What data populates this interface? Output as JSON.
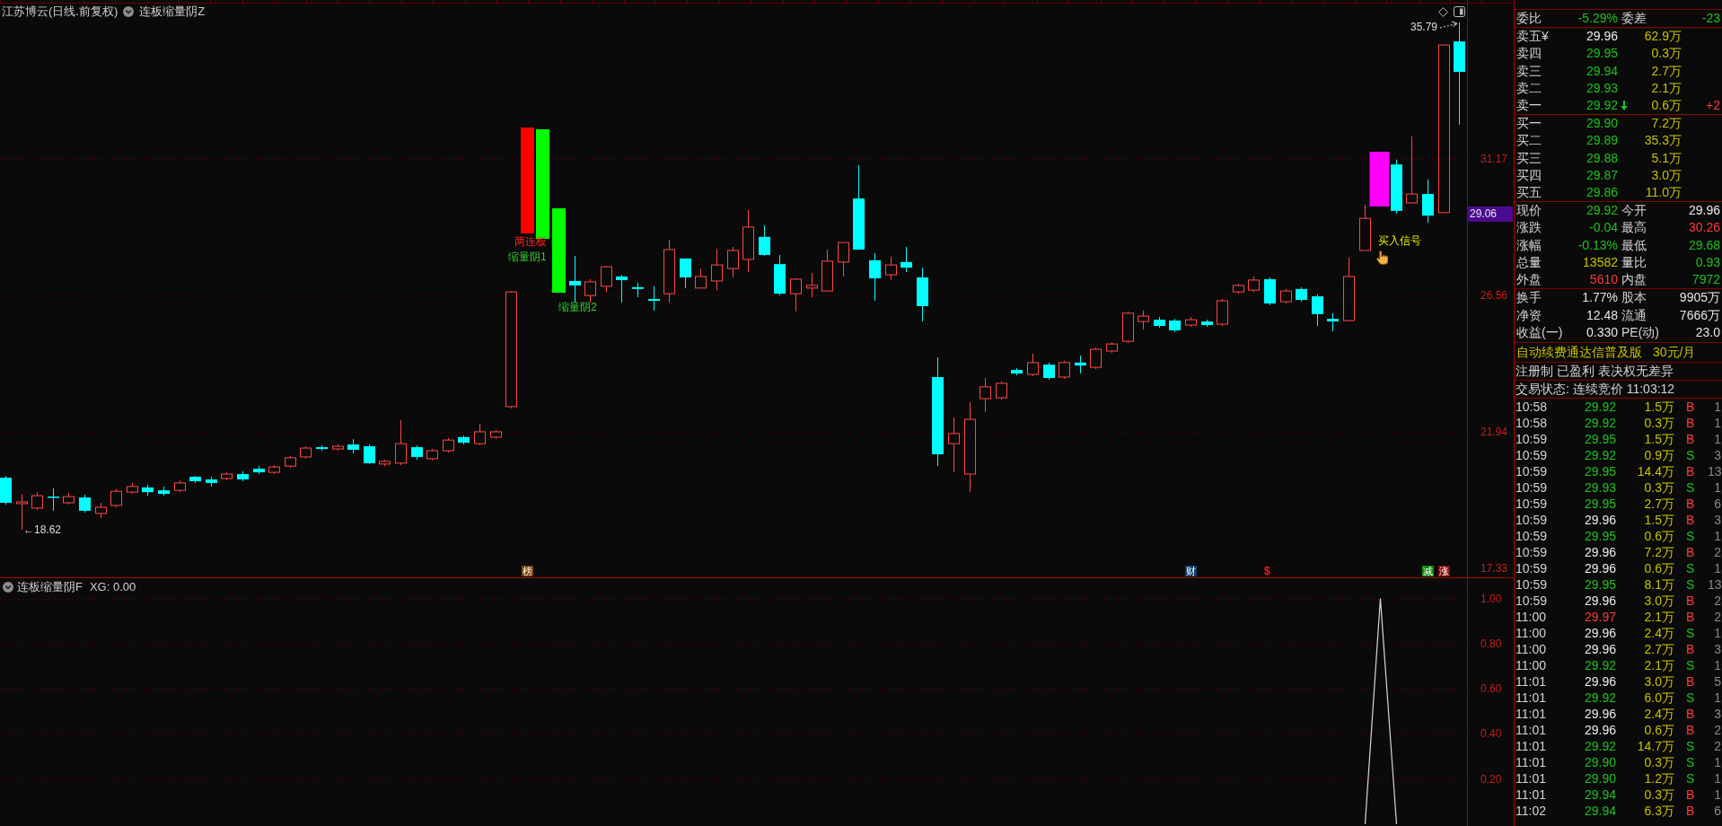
{
  "chart_header": {
    "title": "江苏博云(日线.前复权)",
    "indicator": "连板缩量阴Z"
  },
  "main_chart": {
    "chart_data": {
      "type": "candlestick",
      "ohlc": [
        [
          20.39,
          20.45,
          19.48,
          19.54
        ],
        [
          19.51,
          19.84,
          18.62,
          19.57
        ],
        [
          19.36,
          19.9,
          19.3,
          19.78
        ],
        [
          19.75,
          20.03,
          19.27,
          19.72
        ],
        [
          19.54,
          19.87,
          19.48,
          19.75
        ],
        [
          19.72,
          19.81,
          19.21,
          19.27
        ],
        [
          19.18,
          19.54,
          19.02,
          19.39
        ],
        [
          19.45,
          20.0,
          19.39,
          19.93
        ],
        [
          19.9,
          20.21,
          19.84,
          20.09
        ],
        [
          20.06,
          20.15,
          19.78,
          19.9
        ],
        [
          19.96,
          20.09,
          19.78,
          19.84
        ],
        [
          19.96,
          20.3,
          19.9,
          20.21
        ],
        [
          20.42,
          20.45,
          20.21,
          20.27
        ],
        [
          20.33,
          20.42,
          20.09,
          20.21
        ],
        [
          20.36,
          20.57,
          20.3,
          20.51
        ],
        [
          20.51,
          20.6,
          20.27,
          20.33
        ],
        [
          20.69,
          20.78,
          20.51,
          20.57
        ],
        [
          20.57,
          20.81,
          20.51,
          20.75
        ],
        [
          20.78,
          21.12,
          20.72,
          21.06
        ],
        [
          21.09,
          21.45,
          21.03,
          21.39
        ],
        [
          21.42,
          21.48,
          21.3,
          21.36
        ],
        [
          21.36,
          21.51,
          21.3,
          21.45
        ],
        [
          21.51,
          21.69,
          21.21,
          21.33
        ],
        [
          21.45,
          21.51,
          20.85,
          20.88
        ],
        [
          20.85,
          21.0,
          20.78,
          20.94
        ],
        [
          20.88,
          22.33,
          20.81,
          21.54
        ],
        [
          21.42,
          21.48,
          21.0,
          21.09
        ],
        [
          21.03,
          21.36,
          20.97,
          21.3
        ],
        [
          21.3,
          21.73,
          21.24,
          21.66
        ],
        [
          21.76,
          21.82,
          21.51,
          21.57
        ],
        [
          21.54,
          22.21,
          21.48,
          21.94
        ],
        [
          21.76,
          22.0,
          21.69,
          21.94
        ],
        [
          22.79,
          26.7,
          22.73,
          26.67
        ],
        null,
        null,
        null,
        [
          27.04,
          27.89,
          26.31,
          26.89
        ],
        [
          26.55,
          27.1,
          26.31,
          27.01
        ],
        [
          26.86,
          27.55,
          26.67,
          27.52
        ],
        [
          27.19,
          27.25,
          26.31,
          27.07
        ],
        [
          26.83,
          26.98,
          26.49,
          26.77
        ],
        [
          26.43,
          26.86,
          26.04,
          26.37
        ],
        [
          26.61,
          28.43,
          26.31,
          28.1
        ],
        [
          27.8,
          27.8,
          26.8,
          27.16
        ],
        [
          26.8,
          27.46,
          26.8,
          27.19
        ],
        [
          27.04,
          28.13,
          26.73,
          27.58
        ],
        [
          27.46,
          28.19,
          27.16,
          28.07
        ],
        [
          27.77,
          29.44,
          27.34,
          28.86
        ],
        [
          28.53,
          28.92,
          27.89,
          27.92
        ],
        [
          27.61,
          27.92,
          26.55,
          26.61
        ],
        [
          26.61,
          27.13,
          26.01,
          27.1
        ],
        [
          26.8,
          27.31,
          26.49,
          26.89
        ],
        [
          26.7,
          28.1,
          26.7,
          27.71
        ],
        [
          27.68,
          28.34,
          27.19,
          28.34
        ],
        [
          29.83,
          30.95,
          28.1,
          28.1
        ],
        [
          27.74,
          27.98,
          26.37,
          27.13
        ],
        [
          27.25,
          27.86,
          27.07,
          27.58
        ],
        [
          27.68,
          28.19,
          27.34,
          27.49
        ],
        [
          27.16,
          27.49,
          25.67,
          26.19
        ],
        [
          23.79,
          24.46,
          20.78,
          21.18
        ],
        [
          21.54,
          22.42,
          20.57,
          21.88
        ],
        [
          20.51,
          22.94,
          19.9,
          22.36
        ],
        [
          23.06,
          23.76,
          22.61,
          23.46
        ],
        [
          23.09,
          23.64,
          23.03,
          23.58
        ],
        [
          24.03,
          24.09,
          23.85,
          23.91
        ],
        [
          23.88,
          24.58,
          23.82,
          24.28
        ],
        [
          24.21,
          24.28,
          23.7,
          23.76
        ],
        [
          23.79,
          24.34,
          23.73,
          24.28
        ],
        [
          24.28,
          24.52,
          23.91,
          24.18
        ],
        [
          24.12,
          24.79,
          24.06,
          24.73
        ],
        [
          24.67,
          24.97,
          24.61,
          24.91
        ],
        [
          25.0,
          26.01,
          24.94,
          25.95
        ],
        [
          25.67,
          26.04,
          25.4,
          25.85
        ],
        [
          25.73,
          25.82,
          25.46,
          25.52
        ],
        [
          25.7,
          25.76,
          25.31,
          25.37
        ],
        [
          25.55,
          25.82,
          25.49,
          25.73
        ],
        [
          25.67,
          25.73,
          25.49,
          25.55
        ],
        [
          25.58,
          26.43,
          25.52,
          26.37
        ],
        [
          26.67,
          26.95,
          26.61,
          26.89
        ],
        [
          26.73,
          27.19,
          26.67,
          27.07
        ],
        [
          27.1,
          27.16,
          26.22,
          26.28
        ],
        [
          26.34,
          26.77,
          26.28,
          26.7
        ],
        [
          26.77,
          26.83,
          26.34,
          26.4
        ],
        [
          26.52,
          26.58,
          25.52,
          25.92
        ],
        [
          25.76,
          25.95,
          25.34,
          25.67
        ],
        [
          25.7,
          27.83,
          25.67,
          27.19
        ],
        [
          28.07,
          29.62,
          28.07,
          29.16
        ],
        null,
        [
          30.98,
          31.14,
          29.31,
          29.41
        ],
        [
          29.68,
          31.93,
          29.68,
          29.98
        ],
        [
          29.98,
          30.47,
          29.01,
          29.25
        ],
        [
          29.35,
          35.02,
          29.35,
          35.02
        ],
        [
          35.14,
          35.79,
          32.32,
          34.11
        ]
      ],
      "ylim": [
        17.02,
        36.54
      ],
      "yticks": [
        {
          "value": 31.17,
          "label": "31.17"
        },
        {
          "value": 26.56,
          "label": "26.56"
        },
        {
          "value": 21.94,
          "label": "21.94"
        },
        {
          "value": 17.33,
          "label": "17.33"
        }
      ],
      "grid": true
    },
    "signals": [
      {
        "kind": "limit_up",
        "label": "两连板"
      },
      {
        "kind": "shrink",
        "label": "缩量阴1"
      },
      {
        "kind": "shrink",
        "label": "缩量阴2"
      },
      {
        "kind": "buy",
        "label": "买入信号"
      }
    ],
    "high_label": "35.79",
    "low_label": "←18.62",
    "event_markers": [
      {
        "kind": "tile",
        "text": "榜",
        "color": "#7a3f08"
      },
      {
        "kind": "tile",
        "text": "财",
        "color": "#0f3d6e"
      },
      {
        "kind": "glyph",
        "text": "$",
        "color": "#ff1a1a"
      },
      {
        "kind": "tile",
        "text": "减",
        "color": "#0b8a0b"
      },
      {
        "kind": "tile",
        "text": "涨",
        "color": "#8a0a0a"
      }
    ],
    "last_price_tag": "29.06"
  },
  "indicator_pane": {
    "title": "连板缩量阴F",
    "legend": "XG: 0.00",
    "chart_data": {
      "type": "line",
      "series": [
        {
          "color": "#d8d8d8",
          "values": [
            null,
            null,
            null,
            null,
            null,
            null,
            null,
            null,
            null,
            null,
            null,
            null,
            null,
            null,
            null,
            null,
            null,
            null,
            null,
            null,
            null,
            null,
            null,
            null,
            null,
            null,
            null,
            null,
            null,
            null,
            null,
            null,
            null,
            null,
            null,
            null,
            null,
            null,
            null,
            null,
            null,
            null,
            null,
            null,
            null,
            null,
            null,
            null,
            null,
            null,
            null,
            null,
            null,
            null,
            null,
            null,
            null,
            null,
            null,
            null,
            null,
            null,
            null,
            null,
            null,
            null,
            null,
            null,
            null,
            null,
            null,
            null,
            null,
            null,
            null,
            null,
            null,
            null,
            null,
            null,
            null,
            null,
            null,
            null,
            null,
            null,
            0,
            1,
            0,
            null,
            null,
            null,
            null
          ]
        }
      ],
      "ylim": [
        0,
        1.09
      ],
      "yticks": [
        {
          "value": 1,
          "label": "1.00"
        },
        {
          "value": 0.8,
          "label": "0.80"
        },
        {
          "value": 0.6,
          "label": "0.60"
        },
        {
          "value": 0.4,
          "label": "0.40"
        },
        {
          "value": 0.2,
          "label": "0.20"
        }
      ],
      "grid": true
    }
  },
  "quote_panel": {
    "order_ratio": [
      {
        "label": "委比",
        "value": "-5.29%",
        "color": "#1ec31e"
      },
      {
        "label": "委差",
        "value": "-23",
        "color": "#1ec31e"
      }
    ],
    "asks": [
      {
        "label": "卖五¥",
        "price": "29.96",
        "color": "#eeeeee",
        "volume": "62.9万"
      },
      {
        "label": "卖四",
        "price": "29.95",
        "color": "#1ec31e",
        "volume": "0.3万"
      },
      {
        "label": "卖三",
        "price": "29.94",
        "color": "#1ec31e",
        "volume": "2.7万"
      },
      {
        "label": "卖二",
        "price": "29.93",
        "color": "#1ec31e",
        "volume": "2.1万"
      },
      {
        "label": "卖一",
        "price": "29.92",
        "color": "#1ec31e",
        "arrow_down": true,
        "volume": "0.6万",
        "change": {
          "text": "+2",
          "color": "#ff3b3b"
        }
      }
    ],
    "bids": [
      {
        "label": "买一",
        "price": "29.90",
        "color": "#1ec31e",
        "volume": "7.2万"
      },
      {
        "label": "买二",
        "price": "29.89",
        "color": "#1ec31e",
        "volume": "35.3万"
      },
      {
        "label": "买三",
        "price": "29.88",
        "color": "#1ec31e",
        "volume": "5.1万"
      },
      {
        "label": "买四",
        "price": "29.87",
        "color": "#1ec31e",
        "volume": "3.0万"
      },
      {
        "label": "买五",
        "price": "29.86",
        "color": "#1ec31e",
        "volume": "11.0万"
      }
    ],
    "stats": [
      [
        {
          "label": "现价",
          "value": "29.92",
          "color": "#1ec31e"
        },
        {
          "label": "今开",
          "value": "29.96",
          "color": "#eeeeee"
        }
      ],
      [
        {
          "label": "涨跌",
          "value": "-0.04",
          "color": "#1ec31e"
        },
        {
          "label": "最高",
          "value": "30.26",
          "color": "#ff3b3b"
        }
      ],
      [
        {
          "label": "涨幅",
          "value": "-0.13%",
          "color": "#1ec31e"
        },
        {
          "label": "最低",
          "value": "29.68",
          "color": "#1ec31e"
        }
      ],
      [
        {
          "label": "总量",
          "value": "13582",
          "color": "#c8c300"
        },
        {
          "label": "量比",
          "value": "0.93",
          "color": "#1ec31e"
        }
      ],
      [
        {
          "label": "外盘",
          "value": "5610",
          "color": "#ff3b3b"
        },
        {
          "label": "内盘",
          "value": "7972",
          "color": "#1ec31e"
        }
      ]
    ],
    "fundamentals": [
      [
        {
          "label": "换手",
          "value": "1.77%"
        },
        {
          "label": "股本",
          "value": "9905万"
        }
      ],
      [
        {
          "label": "净资",
          "value": "12.48"
        },
        {
          "label": "流通",
          "value": "7666万"
        }
      ],
      [
        {
          "label": "收益(一)",
          "value": "0.330"
        },
        {
          "label": "PE(动)",
          "value": "23.0"
        }
      ]
    ],
    "notice": [
      "自动续费通达信普及版",
      "30元/月"
    ],
    "tags": "注册制 已盈利 表决权无差异",
    "trading_status": "交易状态: 连续竞价 11:03:12",
    "trades": [
      {
        "time": "10:58",
        "price": "29.92",
        "color": "#1ec31e",
        "volume": "1.5万",
        "side": "B",
        "buy": true,
        "count": "1"
      },
      {
        "time": "10:58",
        "price": "29.92",
        "color": "#1ec31e",
        "volume": "0.3万",
        "side": "B",
        "buy": true,
        "count": "1"
      },
      {
        "time": "10:59",
        "price": "29.95",
        "color": "#1ec31e",
        "volume": "1.5万",
        "side": "B",
        "buy": true,
        "count": "1"
      },
      {
        "time": "10:59",
        "price": "29.92",
        "color": "#1ec31e",
        "volume": "0.9万",
        "side": "S",
        "buy": false,
        "count": "3"
      },
      {
        "time": "10:59",
        "price": "29.95",
        "color": "#1ec31e",
        "volume": "14.4万",
        "side": "B",
        "buy": true,
        "count": "13"
      },
      {
        "time": "10:59",
        "price": "29.93",
        "color": "#1ec31e",
        "volume": "0.3万",
        "side": "S",
        "buy": false,
        "count": "1"
      },
      {
        "time": "10:59",
        "price": "29.95",
        "color": "#1ec31e",
        "volume": "2.7万",
        "side": "B",
        "buy": true,
        "count": "6"
      },
      {
        "time": "10:59",
        "price": "29.96",
        "color": "#eeeeee",
        "volume": "1.5万",
        "side": "B",
        "buy": true,
        "count": "3"
      },
      {
        "time": "10:59",
        "price": "29.95",
        "color": "#1ec31e",
        "volume": "0.6万",
        "side": "S",
        "buy": false,
        "count": "1"
      },
      {
        "time": "10:59",
        "price": "29.96",
        "color": "#eeeeee",
        "volume": "7.2万",
        "side": "B",
        "buy": true,
        "count": "2"
      },
      {
        "time": "10:59",
        "price": "29.96",
        "color": "#eeeeee",
        "volume": "0.6万",
        "side": "S",
        "buy": false,
        "count": "1"
      },
      {
        "time": "10:59",
        "price": "29.95",
        "color": "#1ec31e",
        "volume": "8.1万",
        "side": "S",
        "buy": false,
        "count": "13"
      },
      {
        "time": "10:59",
        "price": "29.96",
        "color": "#eeeeee",
        "volume": "3.0万",
        "side": "B",
        "buy": true,
        "count": "2"
      },
      {
        "time": "11:00",
        "price": "29.97",
        "color": "#ff3b3b",
        "volume": "2.1万",
        "side": "B",
        "buy": true,
        "count": "2"
      },
      {
        "time": "11:00",
        "price": "29.96",
        "color": "#eeeeee",
        "volume": "2.4万",
        "side": "S",
        "buy": false,
        "count": "1"
      },
      {
        "time": "11:00",
        "price": "29.96",
        "color": "#eeeeee",
        "volume": "2.7万",
        "side": "B",
        "buy": true,
        "count": "3"
      },
      {
        "time": "11:00",
        "price": "29.92",
        "color": "#1ec31e",
        "volume": "2.1万",
        "side": "S",
        "buy": false,
        "count": "1"
      },
      {
        "time": "11:01",
        "price": "29.96",
        "color": "#eeeeee",
        "volume": "3.0万",
        "side": "B",
        "buy": true,
        "count": "5"
      },
      {
        "time": "11:01",
        "price": "29.92",
        "color": "#1ec31e",
        "volume": "6.0万",
        "side": "S",
        "buy": false,
        "count": "1"
      },
      {
        "time": "11:01",
        "price": "29.96",
        "color": "#eeeeee",
        "volume": "2.4万",
        "side": "B",
        "buy": true,
        "count": "3"
      },
      {
        "time": "11:01",
        "price": "29.96",
        "color": "#eeeeee",
        "volume": "0.6万",
        "side": "B",
        "buy": true,
        "count": "2"
      },
      {
        "time": "11:01",
        "price": "29.92",
        "color": "#1ec31e",
        "volume": "14.7万",
        "side": "S",
        "buy": false,
        "count": "2"
      },
      {
        "time": "11:01",
        "price": "29.90",
        "color": "#1ec31e",
        "volume": "0.3万",
        "side": "S",
        "buy": false,
        "count": "1"
      },
      {
        "time": "11:01",
        "price": "29.90",
        "color": "#1ec31e",
        "volume": "1.2万",
        "side": "S",
        "buy": false,
        "count": "1"
      },
      {
        "time": "11:01",
        "price": "29.94",
        "color": "#1ec31e",
        "volume": "0.3万",
        "side": "B",
        "buy": true,
        "count": "1"
      },
      {
        "time": "11:02",
        "price": "29.94",
        "color": "#1ec31e",
        "volume": "6.3万",
        "side": "B",
        "buy": true,
        "count": "6"
      }
    ]
  }
}
